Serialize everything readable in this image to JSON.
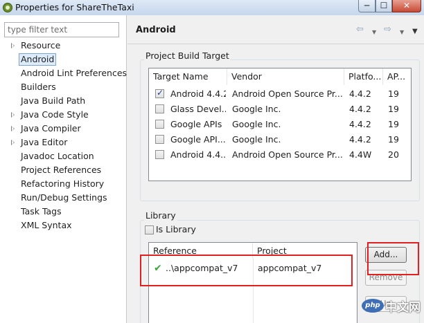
{
  "window": {
    "title": "Properties for ShareTheTaxi",
    "minimize": "─",
    "maximize": "☐",
    "close": "✕"
  },
  "sidebar": {
    "filter_placeholder": "type filter text",
    "items": [
      {
        "label": "Resource",
        "expandable": true
      },
      {
        "label": "Android",
        "selected": true
      },
      {
        "label": "Android Lint Preferences"
      },
      {
        "label": "Builders"
      },
      {
        "label": "Java Build Path"
      },
      {
        "label": "Java Code Style",
        "expandable": true
      },
      {
        "label": "Java Compiler",
        "expandable": true
      },
      {
        "label": "Java Editor",
        "expandable": true
      },
      {
        "label": "Javadoc Location"
      },
      {
        "label": "Project References"
      },
      {
        "label": "Refactoring History"
      },
      {
        "label": "Run/Debug Settings"
      },
      {
        "label": "Task Tags"
      },
      {
        "label": "XML Syntax"
      }
    ]
  },
  "page": {
    "title": "Android",
    "nav_back_icon": "⇦",
    "nav_forward_icon": "⇨",
    "nav_menu_icon": "▼",
    "dropdown_icon": "▼"
  },
  "build_target": {
    "group_label": "Project Build Target",
    "columns": [
      "Target Name",
      "Vendor",
      "Platfo...",
      "AP..."
    ],
    "rows": [
      {
        "checked": true,
        "name": "Android 4.4.2",
        "vendor": "Android Open Source Pr...",
        "platform": "4.4.2",
        "api": "19"
      },
      {
        "checked": false,
        "name": "Glass Devel...",
        "vendor": "Google Inc.",
        "platform": "4.4.2",
        "api": "19"
      },
      {
        "checked": false,
        "name": "Google APIs",
        "vendor": "Google Inc.",
        "platform": "4.4.2",
        "api": "19"
      },
      {
        "checked": false,
        "name": "Google API...",
        "vendor": "Google Inc.",
        "platform": "4.4.2",
        "api": "19"
      },
      {
        "checked": false,
        "name": "Android 4.4...",
        "vendor": "Android Open Source Pr...",
        "platform": "4.4W",
        "api": "20"
      }
    ]
  },
  "library": {
    "group_label": "Library",
    "is_library_label": "Is Library",
    "is_library_checked": false,
    "columns": [
      "Reference",
      "Project"
    ],
    "rows": [
      {
        "reference": "..\\appcompat_v7",
        "project": "appcompat_v7",
        "status_icon": "✔"
      }
    ],
    "add_button": "Add...",
    "remove_button": "Remove",
    "up_button": "Up"
  },
  "watermark": {
    "logo_text": "php",
    "site_text": "中文网"
  },
  "colors": {
    "annotation_red": "#e02020",
    "check_green": "#3aa53a",
    "selection_bg": "#ddecfc"
  }
}
